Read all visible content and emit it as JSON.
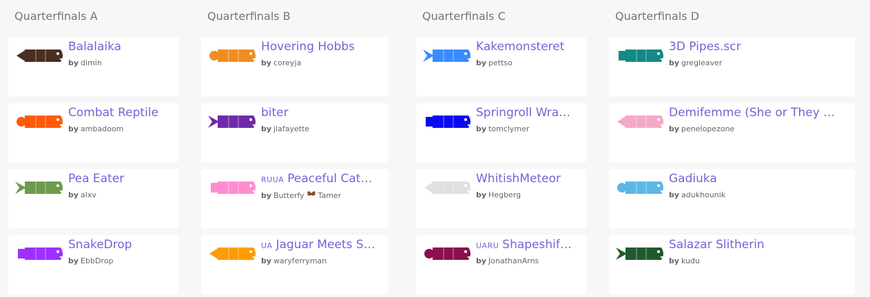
{
  "columns": [
    {
      "title": "Quarterfinals A",
      "entries": [
        {
          "name": "Balalaika",
          "tag": "",
          "by_label": "by",
          "author": "dimin",
          "author_extra": "",
          "color": "#4b2e20",
          "icon": "snake-balalaika-icon"
        },
        {
          "name": "Combat Reptile",
          "tag": "",
          "by_label": "by",
          "author": "ambadoom",
          "author_extra": "",
          "color": "#ff5a0a",
          "icon": "snake-combat-reptile-icon"
        },
        {
          "name": "Pea Eater",
          "tag": "",
          "by_label": "by",
          "author": "alxv",
          "author_extra": "",
          "color": "#6e9a4c",
          "icon": "snake-pea-eater-icon"
        },
        {
          "name": "SnakeDrop",
          "tag": "",
          "by_label": "by",
          "author": "EbbDrop",
          "author_extra": "",
          "color": "#9b30ff",
          "icon": "snake-snakedrop-icon"
        }
      ]
    },
    {
      "title": "Quarterfinals B",
      "entries": [
        {
          "name": "Hovering Hobbs",
          "tag": "",
          "by_label": "by",
          "author": "coreyja",
          "author_extra": "",
          "color": "#ef8d1e",
          "icon": "snake-hovering-hobbs-icon"
        },
        {
          "name": "biter",
          "tag": "",
          "by_label": "by",
          "author": "jlafayette",
          "author_extra": "",
          "color": "#6e2aa8",
          "icon": "snake-biter-icon"
        },
        {
          "name": "Peaceful Cat…",
          "tag": "RUUA",
          "by_label": "by",
          "author": "Butterfy",
          "author_extra": "Tamer",
          "color": "#ff8ccf",
          "icon": "snake-peaceful-cat-icon"
        },
        {
          "name": "Jaguar Meets S…",
          "tag": "UA",
          "by_label": "by",
          "author": "waryferryman",
          "author_extra": "",
          "color": "#ff9b05",
          "icon": "snake-jaguar-icon"
        }
      ]
    },
    {
      "title": "Quarterfinals C",
      "entries": [
        {
          "name": "Kakemonsteret",
          "tag": "",
          "by_label": "by",
          "author": "pettso",
          "author_extra": "",
          "color": "#3b8bff",
          "icon": "snake-kakemonsteret-icon"
        },
        {
          "name": "Springroll Wra…",
          "tag": "",
          "by_label": "by",
          "author": "tomclymer",
          "author_extra": "",
          "color": "#0a0af0",
          "icon": "snake-springroll-icon"
        },
        {
          "name": "WhitishMeteor",
          "tag": "",
          "by_label": "by",
          "author": "Hegberg",
          "author_extra": "",
          "color": "#e0e0e0",
          "icon": "snake-whitishmeteor-icon"
        },
        {
          "name": "Shapeshif…",
          "tag": "UARU",
          "by_label": "by",
          "author": "JonathanArns",
          "author_extra": "",
          "color": "#8c0f4f",
          "icon": "snake-shapeshifter-icon"
        }
      ]
    },
    {
      "title": "Quarterfinals D",
      "entries": [
        {
          "name": "3D Pipes.scr",
          "tag": "",
          "by_label": "by",
          "author": "gregleaver",
          "author_extra": "",
          "color": "#138a85",
          "icon": "snake-3d-pipes-icon"
        },
        {
          "name": "Demifemme (She or They …",
          "tag": "",
          "by_label": "by",
          "author": "penelopezone",
          "author_extra": "",
          "color": "#f5a9c7",
          "icon": "snake-demifemme-icon"
        },
        {
          "name": "Gadiuka",
          "tag": "",
          "by_label": "by",
          "author": "adukhounik",
          "author_extra": "",
          "color": "#5bb8e6",
          "icon": "snake-gadiuka-icon"
        },
        {
          "name": "Salazar Slitherin",
          "tag": "",
          "by_label": "by",
          "author": "kudu",
          "author_extra": "",
          "color": "#1f5a2e",
          "icon": "snake-salazar-icon"
        }
      ]
    }
  ]
}
